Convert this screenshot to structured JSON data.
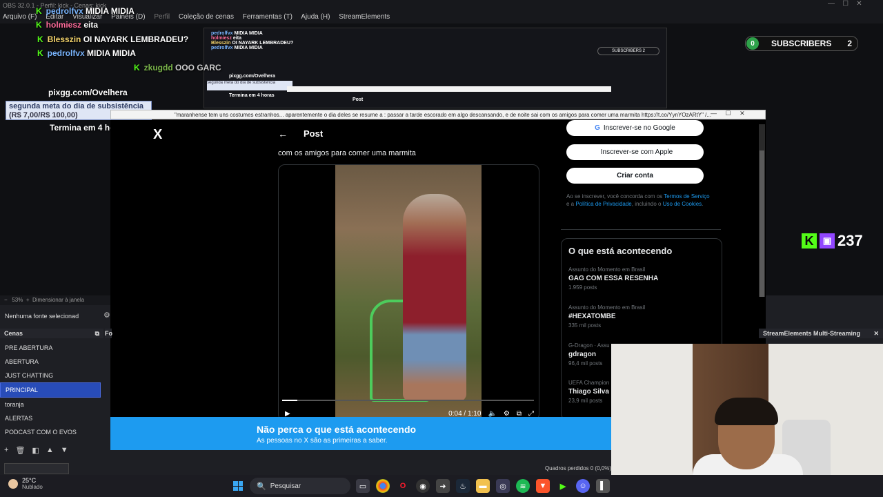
{
  "obs": {
    "title": "OBS 32.0.1 - Perfil: kick - Cenas: kick",
    "menu": [
      "Arquivo (F)",
      "Editar",
      "Visualizar",
      "Painéis (D)",
      "Perfil",
      "Coleção de cenas",
      "Ferramentas (T)",
      "Ajuda (H)",
      "StreamElements"
    ],
    "zoom": "53%",
    "zoom_label": "Dimensionar à janela",
    "no_source": "Nenhuma fonte selecionad",
    "scenes_header": "Cenas",
    "sources_header": "Fo",
    "scenes": [
      "PRE ABERTURA",
      "ABERTURA",
      "JUST CHATTING",
      "PRINCIPAL",
      "toranja",
      "ALERTAS",
      "PODCAST COM O EVOS"
    ],
    "selected_scene": "PRINCIPAL",
    "dropped_frames": "Quadros perdidos 0 (0,0%)",
    "multistream": "StreamElements Multi-Streaming"
  },
  "chat": [
    {
      "user": "pedrolfvx",
      "msg": "MIDIA MIDIA",
      "color": "blue"
    },
    {
      "user": "holmiesz",
      "msg": "eita",
      "color": "pink"
    },
    {
      "user": "Blesszin",
      "msg": "OI NAYARK LEMBRADEU?",
      "color": "yellow"
    },
    {
      "user": "pedrolfvx",
      "msg": "MIDIA MIDIA",
      "color": "blue"
    },
    {
      "user": "zkugdd",
      "msg": "OOO GARC",
      "color": "olive"
    }
  ],
  "overlay": {
    "pix": "pixgg.com/Ovelhera",
    "meta_title": "segunda meta do dia de subsistência",
    "meta_value": "(R$ 7,00/R$ 100,00)",
    "timer": "Termina em 4 horas"
  },
  "subscribers": {
    "badge": "0",
    "label": "SUBSCRIBERS",
    "count": "2"
  },
  "viewers": "237",
  "browser": {
    "title": "\"maranhense tem uns costumes estranhos... aparentemente o dia deles se resume a : passar a tarde escorado em algo descansando, e de noite sai com os amigos para comer uma marmita https://t.co/YynYOzARtY\" /..."
  },
  "x": {
    "logo": "X",
    "post_header": "Post",
    "tweet_text": "com os amigos para comer uma marmita",
    "video_time": "0:04 / 1:10",
    "btn_google": "Inscrever-se no Google",
    "btn_apple": "Inscrever-se com Apple",
    "btn_create": "Criar conta",
    "terms_prefix": "Ao se inscrever, você concorda com os",
    "terms_link": "Termos de Serviço",
    "terms_mid": "e a",
    "privacy_link": "Política de Privacidade",
    "terms_mid2": ", incluindo o",
    "cookies_link": "Uso de Cookies",
    "happening_title": "O que está acontecendo",
    "trends": [
      {
        "context": "Assunto do Momento em Brasil",
        "title": "GAG COM ESSA RESENHA",
        "posts": "1.959 posts"
      },
      {
        "context": "Assunto do Momento em Brasil",
        "title": "#HEXATOMBE",
        "posts": "335 mil posts"
      },
      {
        "context": "G-Dragon · Assu",
        "title": "gdragon",
        "posts": "96,4 mil posts"
      },
      {
        "context": "UEFA Champion",
        "title": "Thiago Silva",
        "posts": "23,9 mil posts"
      }
    ],
    "banner_title": "Não perca o que está acontecendo",
    "banner_sub": "As pessoas no X são as primeiras a saber."
  },
  "taskbar": {
    "temp": "25°C",
    "weather": "Nublado",
    "search": "Pesquisar"
  }
}
